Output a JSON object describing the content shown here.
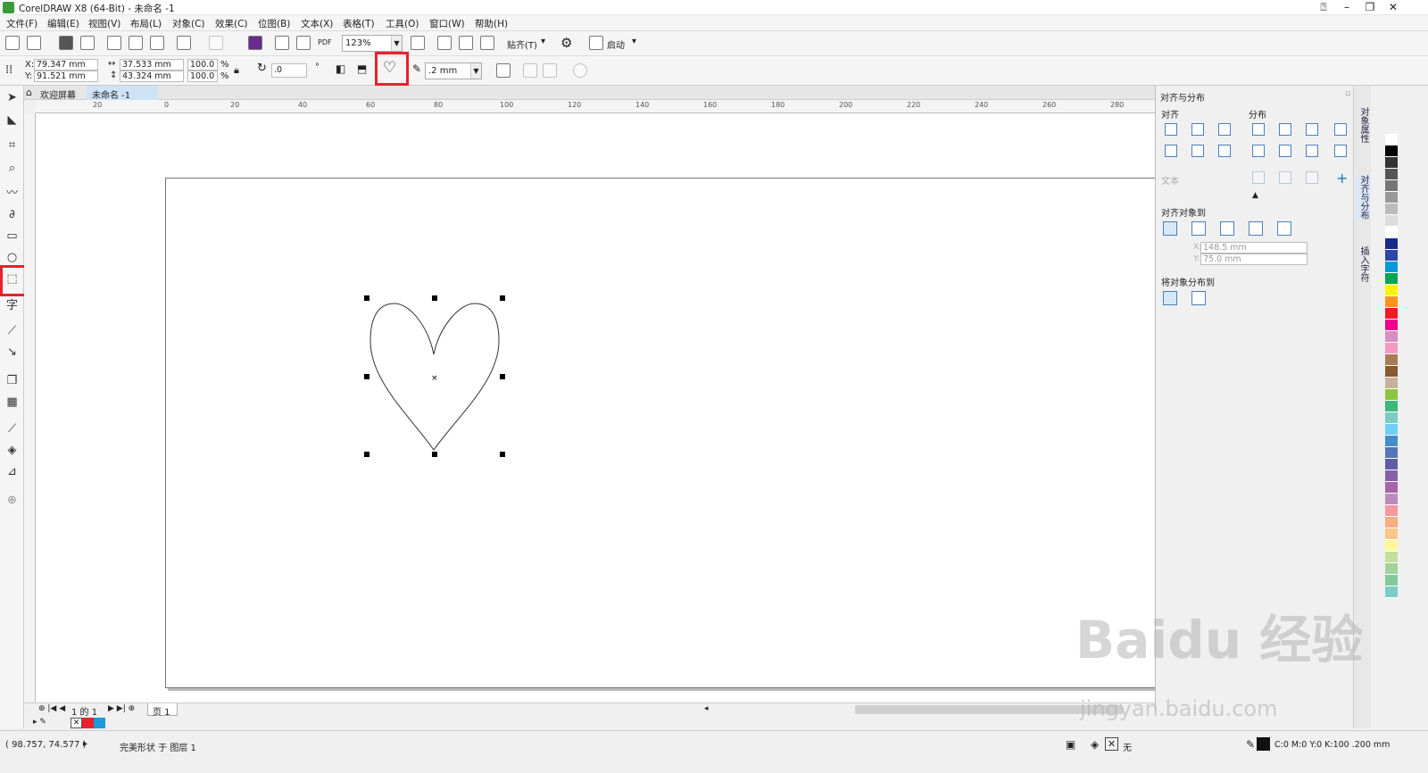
{
  "window": {
    "title": "CorelDRAW X8 (64-Bit) - 未命名 -1"
  },
  "menu": [
    "文件(F)",
    "编辑(E)",
    "视图(V)",
    "布局(L)",
    "对象(C)",
    "效果(C)",
    "位图(B)",
    "文本(X)",
    "表格(T)",
    "工具(O)",
    "窗口(W)",
    "帮助(H)"
  ],
  "toolbar": {
    "zoom": "123%",
    "snap": "贴齐(T)",
    "launch": "启动",
    "pdf": "PDF"
  },
  "propbar": {
    "x": "79.347 mm",
    "y": "91.521 mm",
    "w": "37.533 mm",
    "h": "43.324 mm",
    "scale_x": "100.0",
    "scale_y": "100.0",
    "pct": "%",
    "rotation": ".0",
    "outline": ".2 mm",
    "x_label": "X:",
    "y_label": "Y:"
  },
  "tabs": {
    "welcome": "欢迎屏幕",
    "doc": "未命名 -1"
  },
  "ruler": {
    "h": [
      "20",
      "0",
      "20",
      "40",
      "60",
      "80",
      "100",
      "120",
      "140",
      "160",
      "180",
      "200",
      "220",
      "240",
      "260",
      "280"
    ]
  },
  "pages": {
    "nav": "1 的 1",
    "page": "页 1"
  },
  "status": {
    "coords": "( 98.757, 74.577 )",
    "desc": "完美形状 于 图层 1",
    "fill": "无",
    "outline": "C:0 M:0 Y:0 K:100  .200 mm"
  },
  "docker": {
    "title": "对齐与分布",
    "align": "对齐",
    "distribute": "分布",
    "text": "文本",
    "align_to": "对齐对象到",
    "x_value": "148.5 mm",
    "y_value": "75.0 mm",
    "x_label": "X:",
    "y_label": "Y:",
    "distribute_to": "将对象分布到"
  },
  "docker_tabs": [
    "对象属性",
    "对齐与分布",
    "插入字符"
  ],
  "watermark": {
    "main": "Baidu 经验",
    "url": "jingyan.baidu.com"
  },
  "colors": {
    "accent_red": "#e8212b",
    "swatches": [
      "#ffffff",
      "#000000",
      "#333333",
      "#555555",
      "#777777",
      "#999999",
      "#bbbbbb",
      "#dddddd",
      "#ffffff",
      "#1a2a8a",
      "#2b47a8",
      "#009ad8",
      "#00a651",
      "#fff200",
      "#f7941d",
      "#ed1c24",
      "#ec008c",
      "#d58fc0",
      "#f49ac1",
      "#a67c52",
      "#8a5a32",
      "#c7b299",
      "#8dc63f",
      "#3cb878",
      "#7accc8",
      "#6dcff6",
      "#448ccb",
      "#5674b9",
      "#605ca8",
      "#8560a8",
      "#a864a8",
      "#bd8cbf",
      "#f6989d",
      "#f9ad81",
      "#fdc689",
      "#fff799",
      "#c4df9b",
      "#a3d39c",
      "#82ca9c",
      "#7bcdc8"
    ]
  }
}
